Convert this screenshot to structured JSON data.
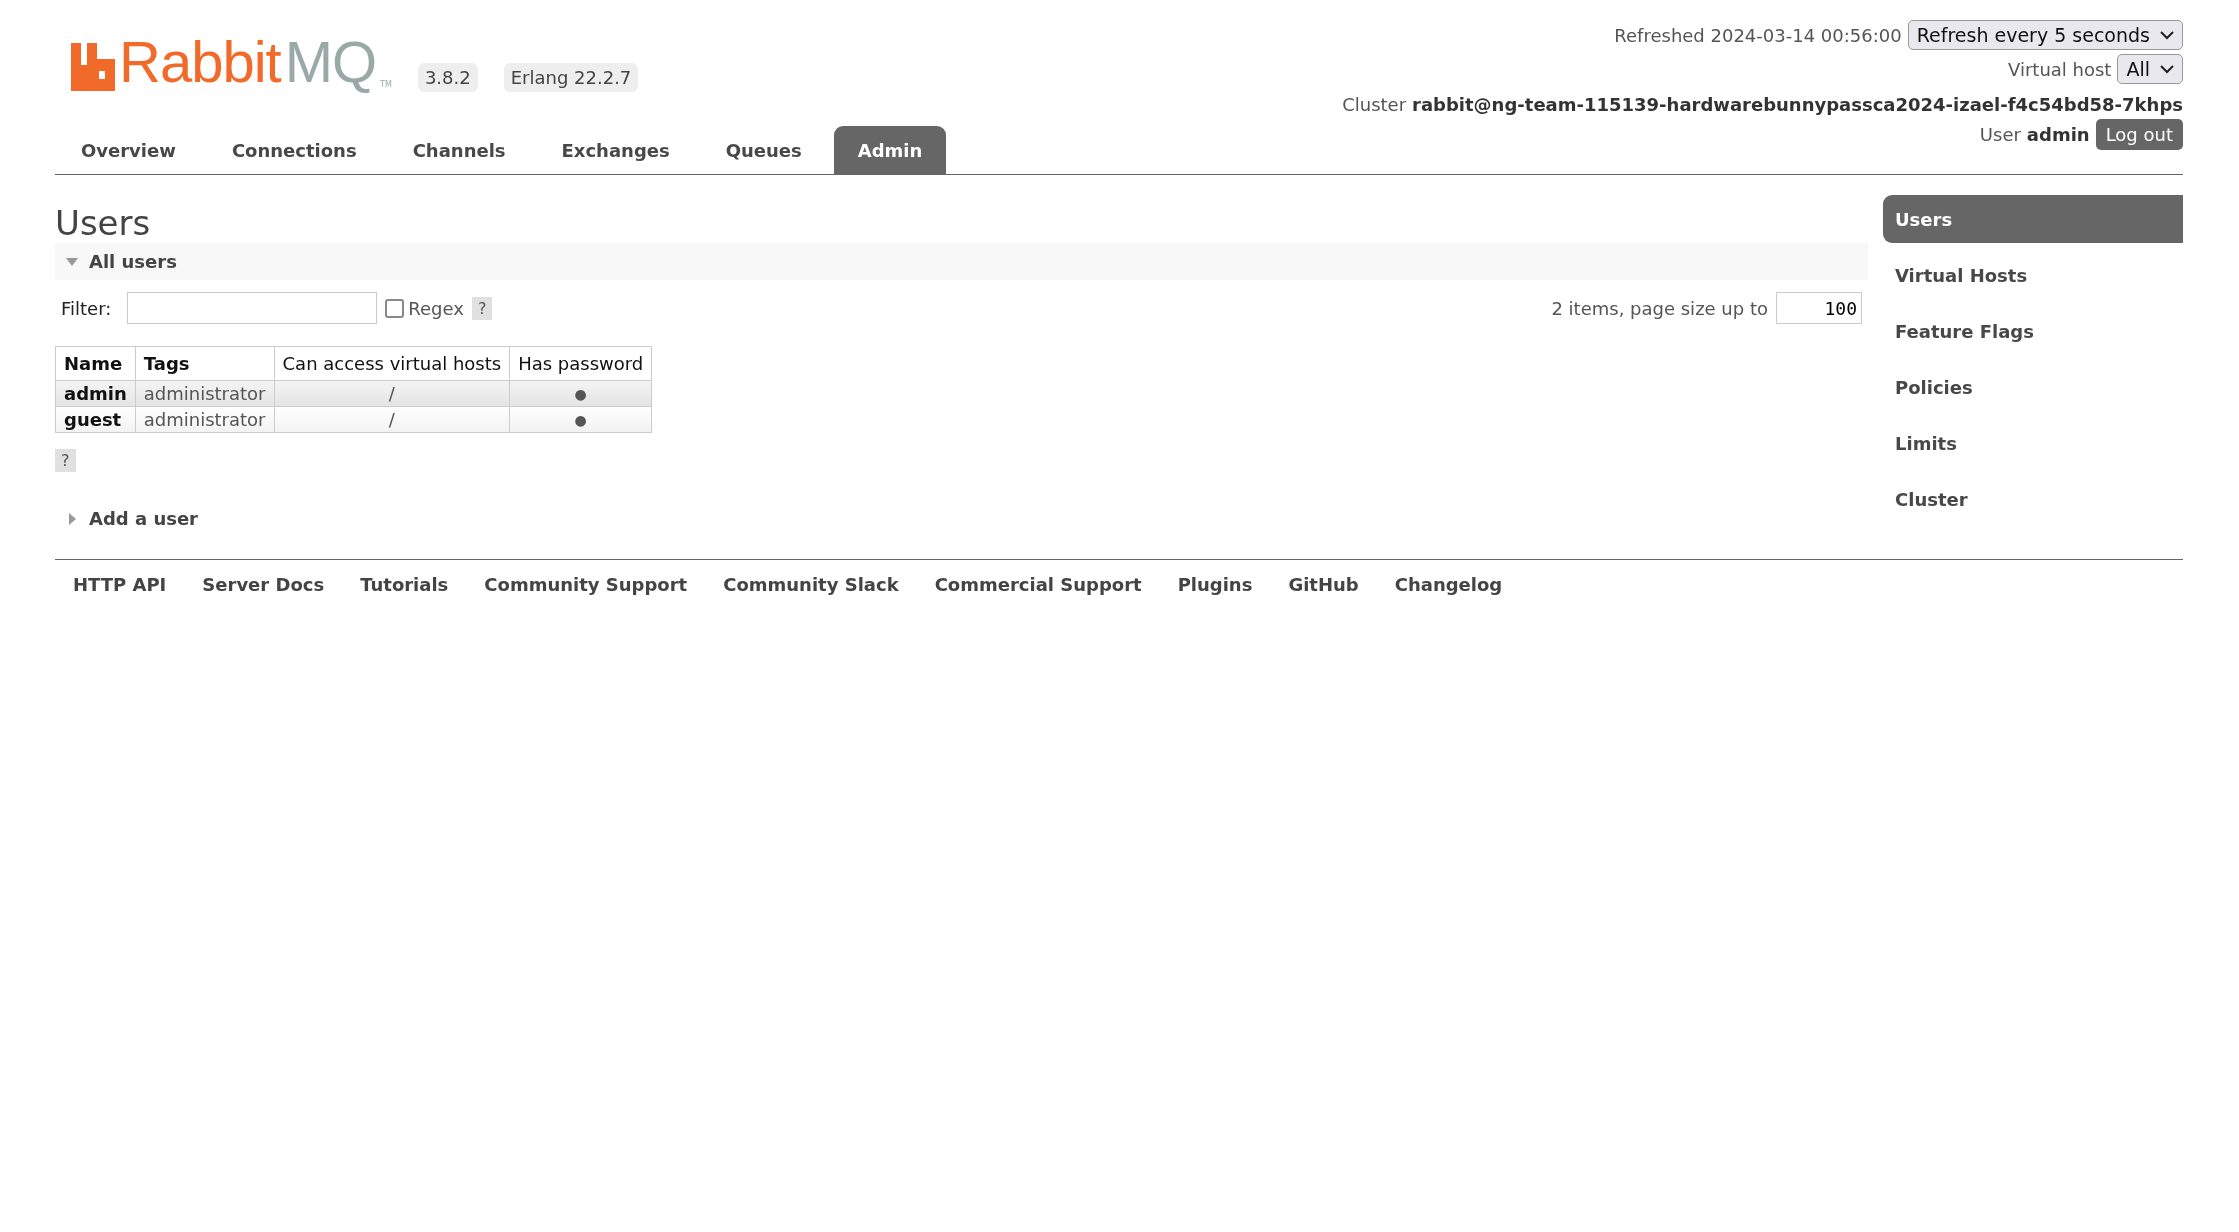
{
  "header": {
    "logo": {
      "text_1": "Rabbit",
      "text_2": "MQ",
      "tm": "TM"
    },
    "version": "3.8.2",
    "erlang": "Erlang 22.2.7",
    "refreshed": "Refreshed 2024-03-14 00:56:00",
    "refresh_select": "Refresh every 5 seconds",
    "vhost_label": "Virtual host",
    "vhost_select": "All",
    "cluster_label": "Cluster",
    "cluster_name": "rabbit@ng-team-115139-hardwarebunnypassca2024-izael-f4c54bd58-7khps",
    "user_label": "User",
    "user_name": "admin",
    "logout": "Log out"
  },
  "tabs": [
    {
      "label": "Overview",
      "selected": false
    },
    {
      "label": "Connections",
      "selected": false
    },
    {
      "label": "Channels",
      "selected": false
    },
    {
      "label": "Exchanges",
      "selected": false
    },
    {
      "label": "Queues",
      "selected": false
    },
    {
      "label": "Admin",
      "selected": true
    }
  ],
  "page_title": "Users",
  "all_users": {
    "title": "All users",
    "expanded": true,
    "filter_label": "Filter:",
    "regex_label": "Regex",
    "regex_checked": false,
    "help": "?",
    "pagination": "2 items, page size up to",
    "page_size": "100",
    "table": {
      "columns": [
        "Name",
        "Tags",
        "Can access virtual hosts",
        "Has password"
      ],
      "rows": [
        {
          "name": "admin",
          "tags": "administrator",
          "vhosts": "/",
          "password": "●"
        },
        {
          "name": "guest",
          "tags": "administrator",
          "vhosts": "/",
          "password": "●"
        }
      ]
    },
    "table_help": "?"
  },
  "add_user": {
    "title": "Add a user",
    "expanded": false
  },
  "sidebar": {
    "items": [
      {
        "label": "Users",
        "selected": true
      },
      {
        "label": "Virtual Hosts",
        "selected": false
      },
      {
        "label": "Feature Flags",
        "selected": false
      },
      {
        "label": "Policies",
        "selected": false
      },
      {
        "label": "Limits",
        "selected": false
      },
      {
        "label": "Cluster",
        "selected": false
      }
    ]
  },
  "footer": {
    "links": [
      "HTTP API",
      "Server Docs",
      "Tutorials",
      "Community Support",
      "Community Slack",
      "Commercial Support",
      "Plugins",
      "GitHub",
      "Changelog"
    ]
  }
}
